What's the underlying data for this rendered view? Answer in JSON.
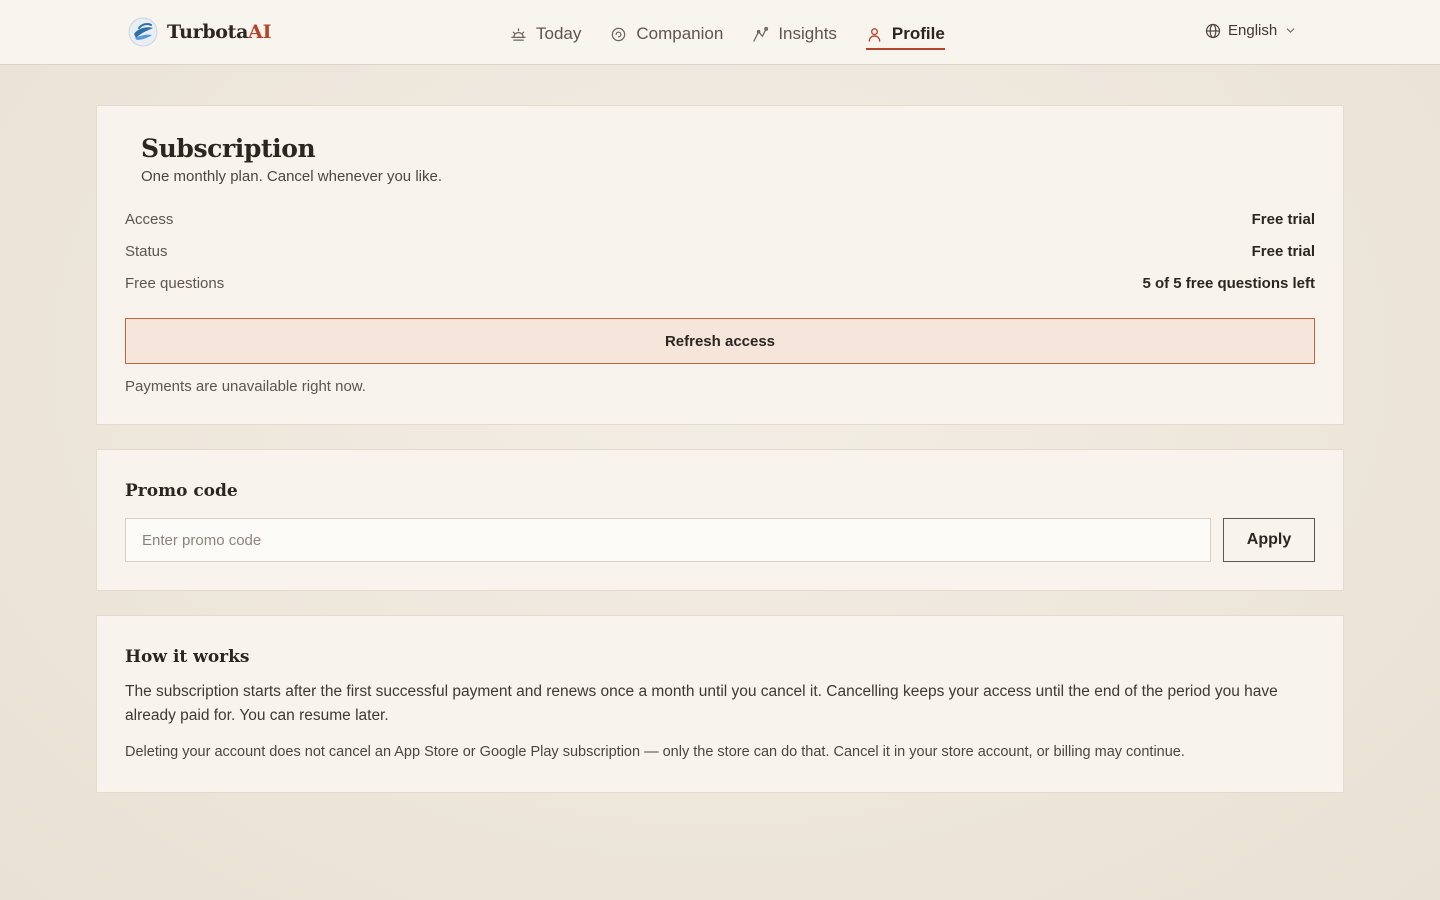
{
  "header": {
    "logo_text": "Turbota",
    "logo_accent": "AI",
    "nav": [
      {
        "label": "Today",
        "icon": "sunrise-icon",
        "active": false
      },
      {
        "label": "Companion",
        "icon": "companion-icon",
        "active": false
      },
      {
        "label": "Insights",
        "icon": "insights-icon",
        "active": false
      },
      {
        "label": "Profile",
        "icon": "user-icon",
        "active": true
      }
    ],
    "language": "English"
  },
  "subscription": {
    "title": "Subscription",
    "description": "One monthly plan. Cancel whenever you like.",
    "rows": [
      {
        "label": "Access",
        "value": "Free trial"
      },
      {
        "label": "Status",
        "value": "Free trial"
      },
      {
        "label": "Free questions",
        "value": "5 of 5 free questions left"
      }
    ],
    "refresh_label": "Refresh access",
    "payment_note": "Payments are unavailable right now."
  },
  "promo": {
    "title": "Promo code",
    "placeholder": "Enter promo code",
    "value": "",
    "apply_label": "Apply"
  },
  "how_it_works": {
    "title": "How it works",
    "paragraph1": "The subscription starts after the first successful payment and renews once a month until you cancel it. Cancelling keeps your access until the end of the period you have already paid for. You can resume later.",
    "paragraph2": "Deleting your account does not cancel an App Store or Google Play subscription — only the store can do that. Cancel it in your store account, or billing may continue."
  },
  "colors": {
    "accent": "#b5452a",
    "background": "#ece4d8",
    "card": "#f8f4ed",
    "refresh_bg": "#f6e5da"
  }
}
